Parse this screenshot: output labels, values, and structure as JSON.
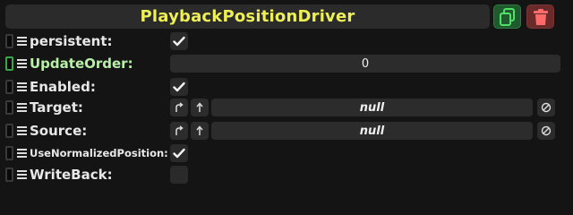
{
  "component": {
    "title": "PlaybackPositionDriver",
    "duplicate_icon": "duplicate-icon",
    "delete_icon": "trash-icon"
  },
  "fields": {
    "persistent": {
      "label": "persistent:",
      "checked": true
    },
    "update_order": {
      "label": "UpdateOrder:",
      "value": "0"
    },
    "enabled": {
      "label": "Enabled:",
      "checked": true
    },
    "target": {
      "label": "Target:",
      "value": "null"
    },
    "source": {
      "label": "Source:",
      "value": "null"
    },
    "use_normalized_position": {
      "label": "UseNormalizedPosition:",
      "checked": true
    },
    "write_back": {
      "label": "WriteBack:",
      "checked": false
    }
  },
  "colors": {
    "title": "#eeee55",
    "duplicate_button": "#1f5a2c",
    "delete_button": "#6a2a2a",
    "highlight_label": "#b8f0a8"
  }
}
